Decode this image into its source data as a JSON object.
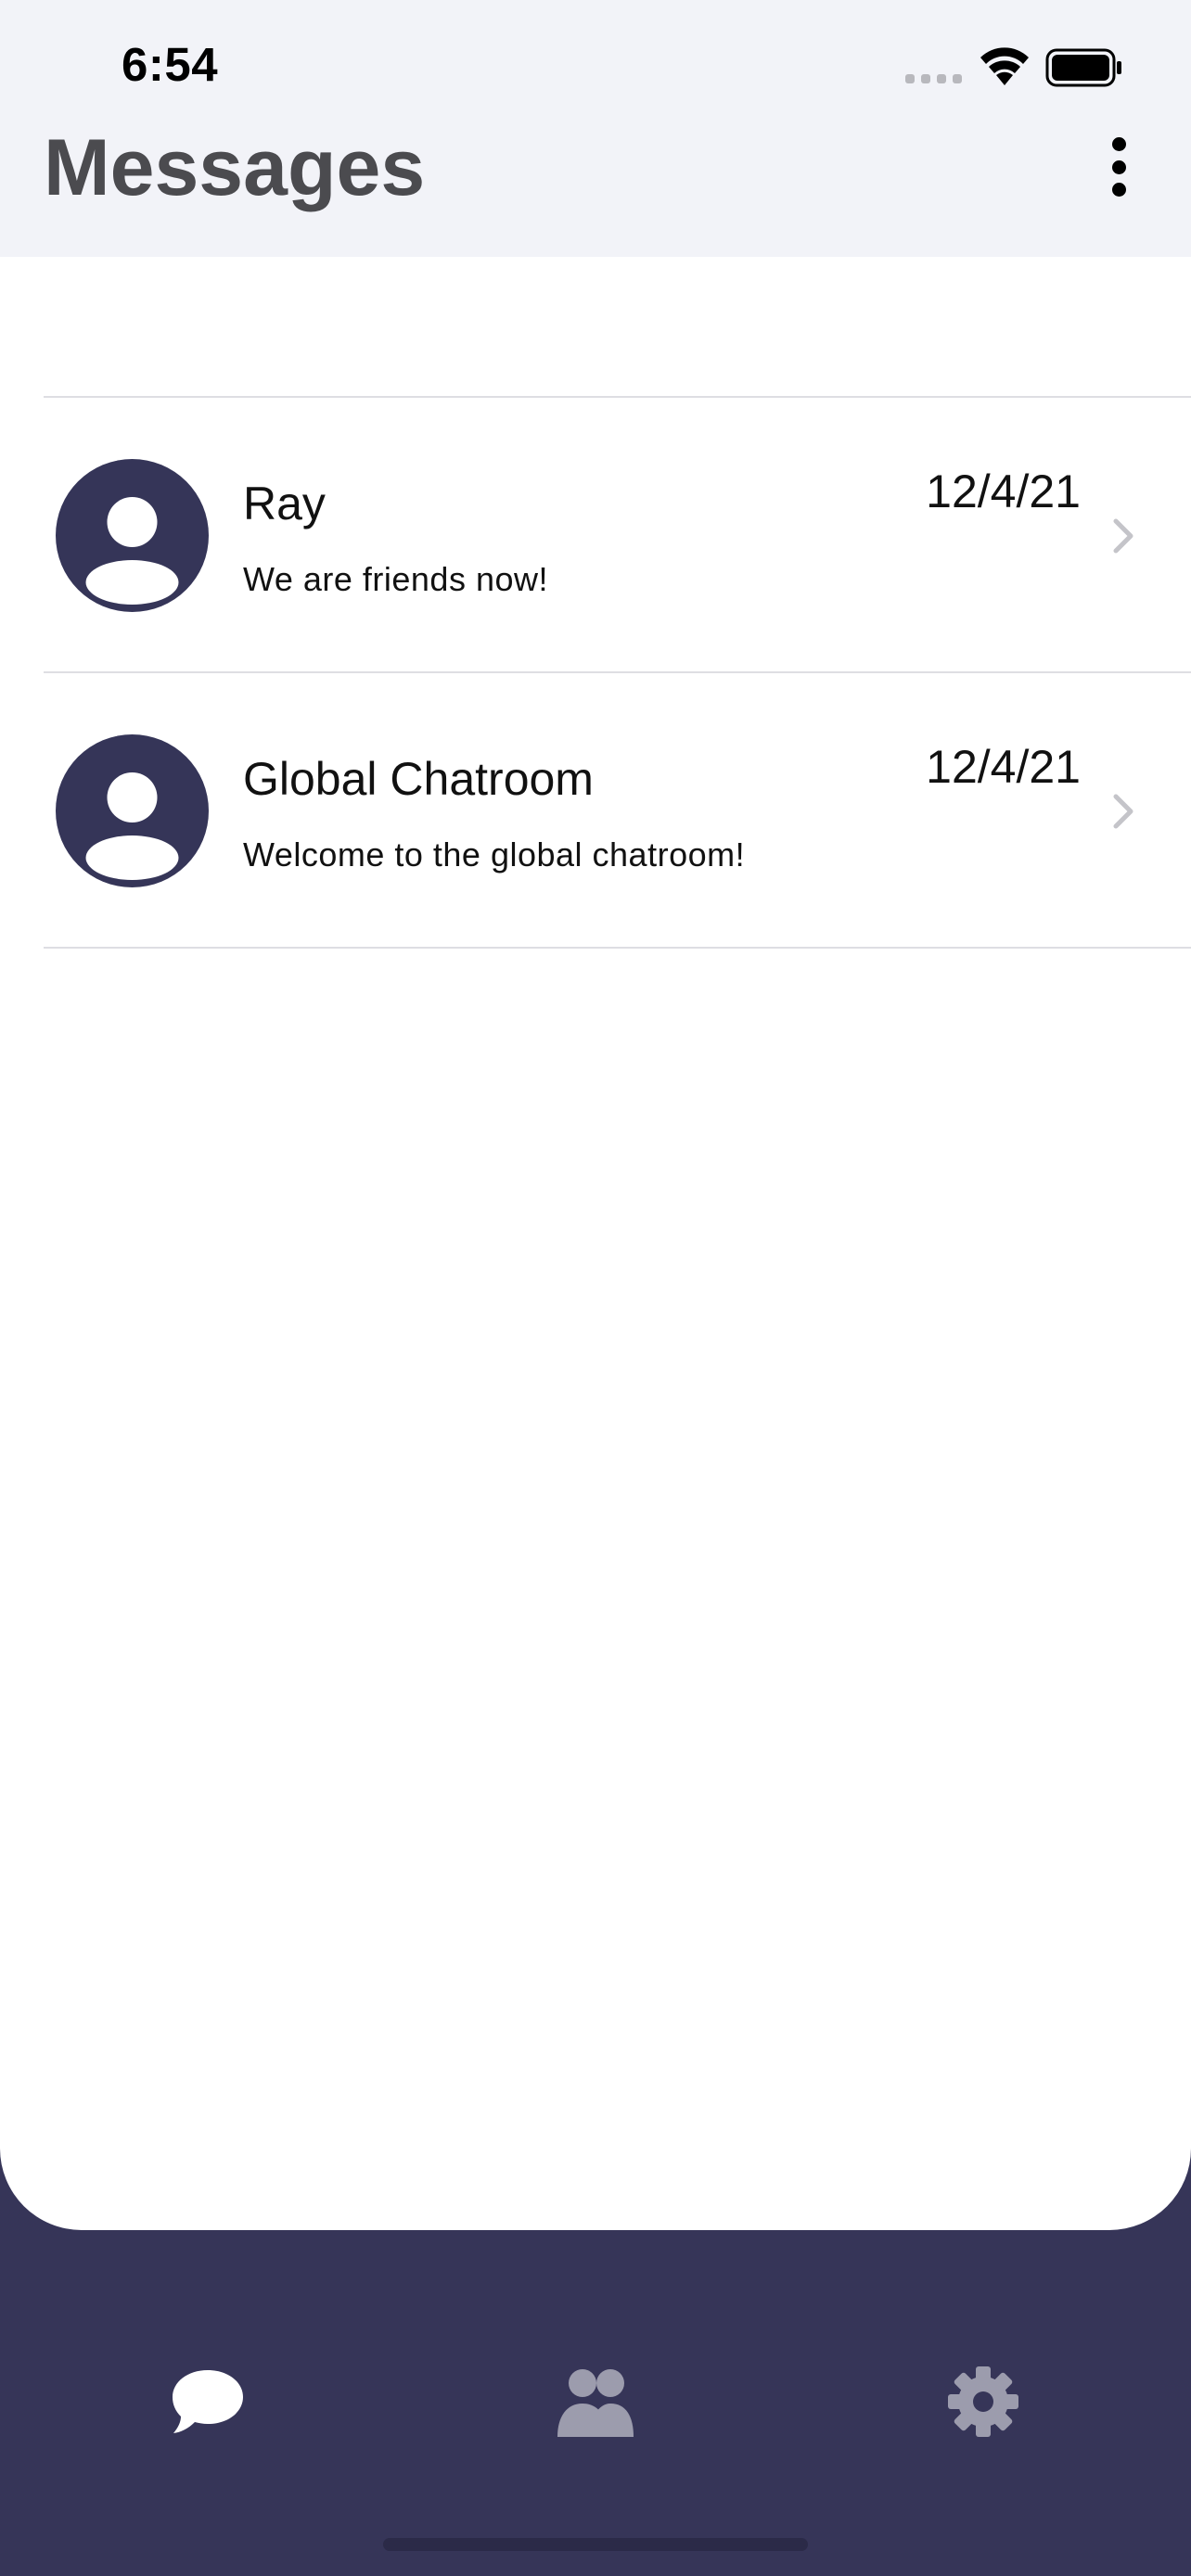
{
  "status_bar": {
    "time": "6:54"
  },
  "header": {
    "title": "Messages",
    "menu_icon": "more-vertical-icon"
  },
  "conversations": [
    {
      "name": "Ray",
      "preview": "We are friends now!",
      "date": "12/4/21",
      "avatar_icon": "user-avatar-icon"
    },
    {
      "name": "Global Chatroom",
      "preview": "Welcome to the global chatroom!",
      "date": "12/4/21",
      "avatar_icon": "user-avatar-icon"
    }
  ],
  "tab_bar": {
    "tabs": [
      {
        "icon": "chat-bubble-icon",
        "active": true
      },
      {
        "icon": "users-icon",
        "active": false
      },
      {
        "icon": "gear-icon",
        "active": false
      }
    ]
  },
  "colors": {
    "header_bg": "#f2f3f8",
    "accent_navy": "#363558",
    "title_text": "#4b4b4f",
    "tab_active": "#ffffff",
    "tab_inactive": "#9c9cad"
  }
}
